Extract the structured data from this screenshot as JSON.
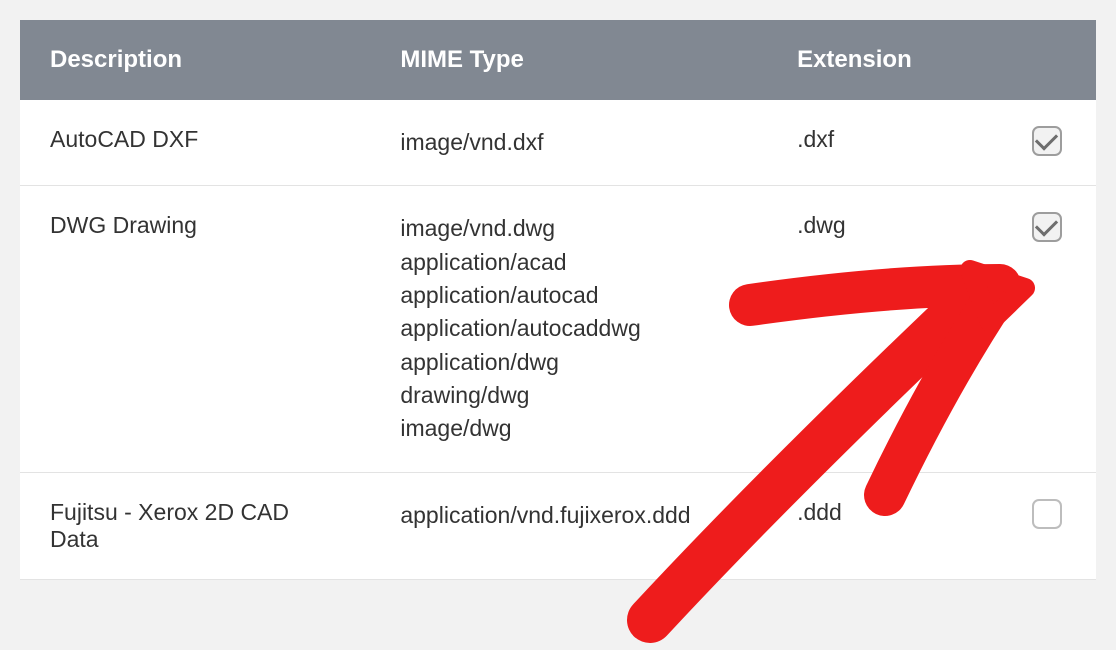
{
  "table": {
    "headers": {
      "description": "Description",
      "mime": "MIME Type",
      "extension": "Extension"
    },
    "rows": [
      {
        "description": "AutoCAD DXF",
        "mimes": [
          "image/vnd.dxf"
        ],
        "extension": ".dxf",
        "checked": true
      },
      {
        "description": "DWG Drawing",
        "mimes": [
          "image/vnd.dwg",
          "application/acad",
          "application/autocad",
          "application/autocaddwg",
          "application/dwg",
          "drawing/dwg",
          "image/dwg"
        ],
        "extension": ".dwg",
        "checked": true
      },
      {
        "description": "Fujitsu - Xerox 2D CAD Data",
        "mimes": [
          "application/vnd.fujixerox.ddd"
        ],
        "extension": ".ddd",
        "checked": false
      }
    ]
  }
}
